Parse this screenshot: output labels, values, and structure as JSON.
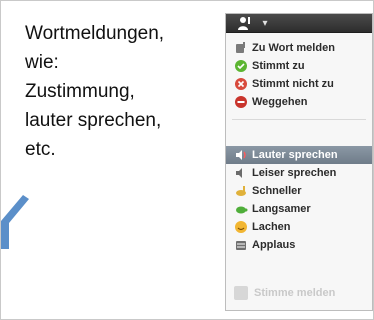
{
  "caption": {
    "lines": [
      "Wortmeldungen,",
      "wie:",
      "Zustimmung,",
      "lauter sprechen,",
      "etc."
    ]
  },
  "menu": {
    "header": {
      "user_icon": "user-raise-hand-icon",
      "dropdown_icon": "chevron-down-icon"
    },
    "primary_items": [
      {
        "label": "Zu Wort melden",
        "icon": "raise-hand-icon",
        "color": "#6d6d6d"
      },
      {
        "label": "Stimmt zu",
        "icon": "check-circle-icon",
        "color": "#5cb531"
      },
      {
        "label": "Stimmt nicht zu",
        "icon": "x-circle-icon",
        "color": "#d84a3c"
      },
      {
        "label": "Weggehen",
        "icon": "minus-circle-icon",
        "color": "#c9342c"
      }
    ],
    "secondary_items": [
      {
        "label": "Lauter sprechen",
        "icon": "speaker-loud-icon",
        "active": true
      },
      {
        "label": "Leiser sprechen",
        "icon": "speaker-quiet-icon"
      },
      {
        "label": "Schneller",
        "icon": "hare-icon"
      },
      {
        "label": "Langsamer",
        "icon": "turtle-icon"
      },
      {
        "label": "Lachen",
        "icon": "laugh-icon"
      },
      {
        "label": "Applaus",
        "icon": "applause-icon"
      }
    ],
    "bottom_item": {
      "label": "Stimme melden",
      "icon": "disabled-item-icon"
    }
  }
}
